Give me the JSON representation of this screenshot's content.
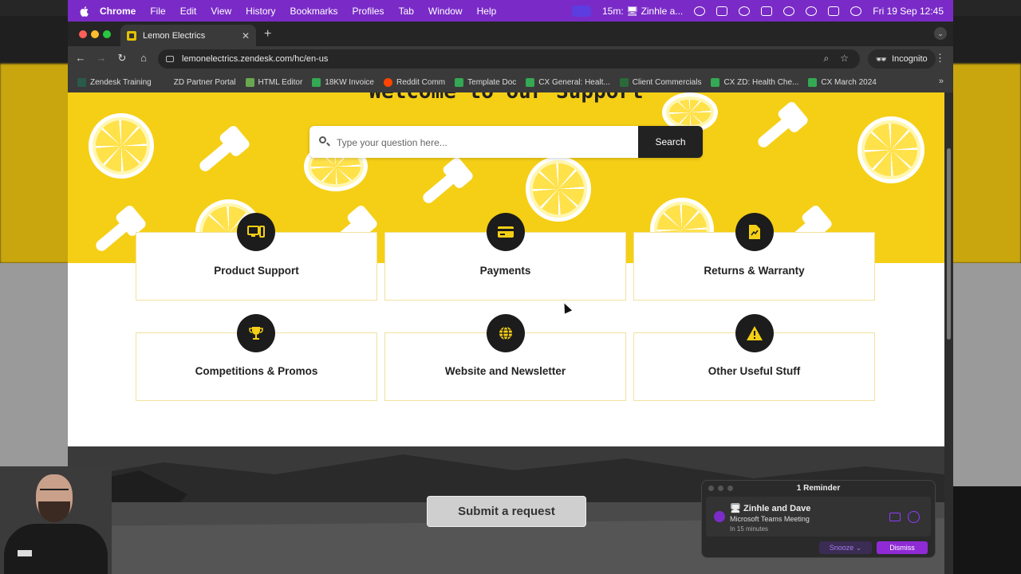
{
  "os_menubar": {
    "app": "Chrome",
    "items": [
      "File",
      "Edit",
      "View",
      "History",
      "Bookmarks",
      "Profiles",
      "Tab",
      "Window",
      "Help"
    ],
    "status_meeting": "15m: 🖥 Zinhle a...",
    "datetime": "Fri 19 Sep  12:45"
  },
  "browser": {
    "tab_title": "Lemon Electrics",
    "url": "lemonelectrics.zendesk.com/hc/en-us",
    "mode_label": "Incognito",
    "bookmarks": [
      {
        "label": "Zendesk Training",
        "color": "#2a5a4a"
      },
      {
        "label": "ZD Partner Portal",
        "color": "#3a3a3a"
      },
      {
        "label": "HTML Editor",
        "color": "#6aa84f"
      },
      {
        "label": "18KW Invoice",
        "color": "#34a853"
      },
      {
        "label": "Reddit Comm",
        "color": "#ff4500"
      },
      {
        "label": "Template Doc",
        "color": "#34a853"
      },
      {
        "label": "CX General: Healt...",
        "color": "#34a853"
      },
      {
        "label": "Client Commercials",
        "color": "#2a6a3a"
      },
      {
        "label": "CX ZD: Health Che...",
        "color": "#34a853"
      },
      {
        "label": "CX March 2024",
        "color": "#34a853"
      }
    ]
  },
  "page": {
    "hero_title": "Welcome to our Support",
    "search_placeholder": "Type your question here...",
    "search_button": "Search",
    "categories": [
      {
        "label": "Product Support",
        "icon": "devices-icon"
      },
      {
        "label": "Payments",
        "icon": "credit-card-icon"
      },
      {
        "label": "Returns & Warranty",
        "icon": "document-icon"
      },
      {
        "label": "Competitions & Promos",
        "icon": "trophy-icon"
      },
      {
        "label": "Website and Newsletter",
        "icon": "globe-icon"
      },
      {
        "label": "Other Useful Stuff",
        "icon": "warning-icon"
      }
    ],
    "submit_request": "Submit a request"
  },
  "reminder": {
    "header": "1 Reminder",
    "title": "🖥 Zinhle and Dave",
    "subtitle": "Microsoft Teams Meeting",
    "time": "In 15 minutes",
    "snooze": "Snooze",
    "dismiss": "Dismiss"
  },
  "colors": {
    "brand_yellow": "#f5cf16",
    "badge_dark": "#1c1c1c",
    "menubar_purple": "#7a2bc7",
    "dismiss_purple": "#8f2bd4"
  }
}
